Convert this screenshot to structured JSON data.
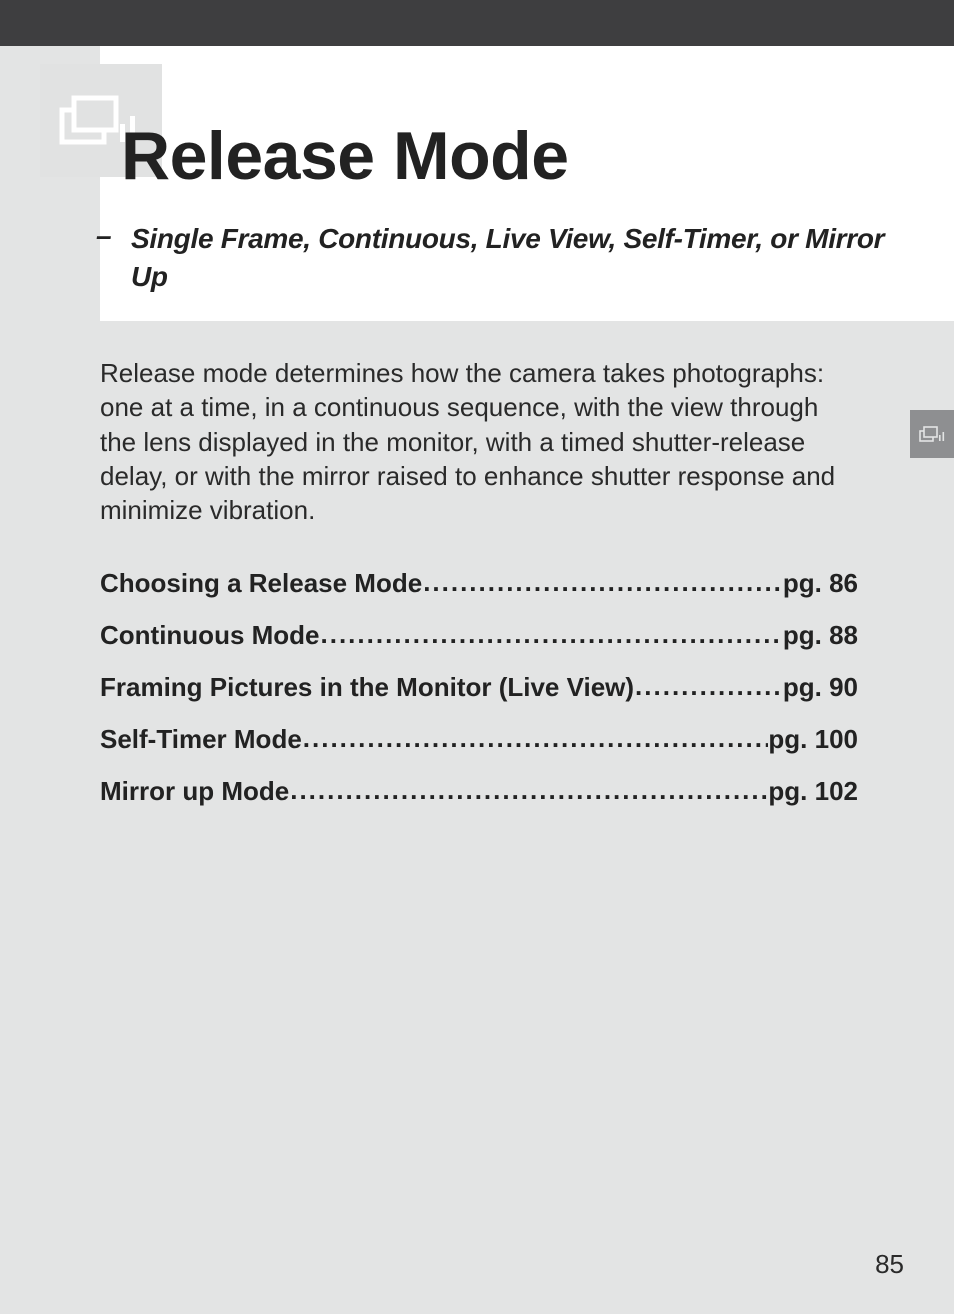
{
  "chapter": {
    "title": "Release Mode",
    "subtitle_dash": "–",
    "subtitle": "Single Frame, Continuous, Live View, Self-Timer, or Mirror Up"
  },
  "intro_paragraph": "Release mode determines how the camera takes photographs: one at a time, in a continuous sequence, with the view through the lens displayed in the monitor, with a timed shutter-release delay, or with the mirror raised to enhance shutter response and minimize vibration.",
  "toc": [
    {
      "label": "Choosing a Release Mode",
      "page": "pg. 86"
    },
    {
      "label": "Continuous Mode",
      "page": "pg. 88"
    },
    {
      "label": "Framing Pictures in the Monitor (Live View)",
      "page": "pg. 90"
    },
    {
      "label": "Self-Timer Mode ",
      "page": " pg. 100"
    },
    {
      "label": "Mirror up Mode",
      "page": " pg. 102"
    }
  ],
  "page_number": "85",
  "icons": {
    "chapter_icon": "continuous-frames-icon",
    "side_tab_icon": "continuous-frames-icon"
  },
  "colors": {
    "page_bg": "#e3e4e4",
    "top_bar": "#3e3e40",
    "icon_block": "#e1e2e2",
    "side_tab": "#8e8f91",
    "white": "#ffffff"
  }
}
